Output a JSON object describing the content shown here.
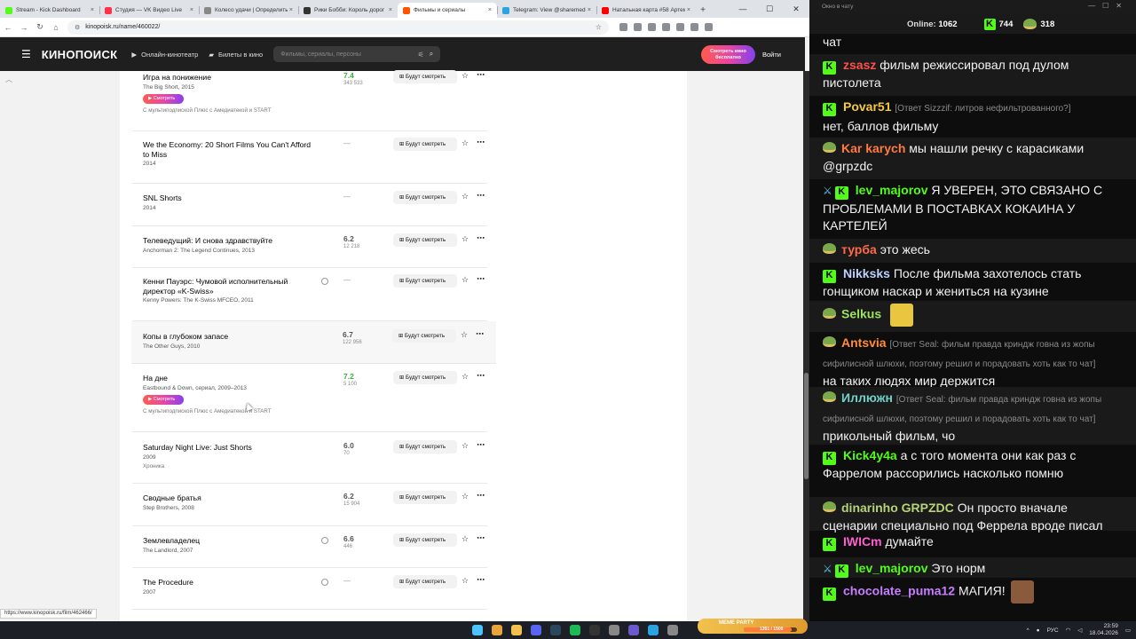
{
  "browser": {
    "tabs": [
      {
        "label": "Stream - Kick Dashboard",
        "color": "#53fc18"
      },
      {
        "label": "Студия — VK Видео Live",
        "color": "#ff3347"
      },
      {
        "label": "Колесо удачи | Определить",
        "color": "#888888"
      },
      {
        "label": "Рики Бобби: Король дорог",
        "color": "#333333"
      },
      {
        "label": "Фильмы и сериалы",
        "color": "#ff5500",
        "active": true
      },
      {
        "label": "Telegram: View @sharemed",
        "color": "#2aa3e0"
      },
      {
        "label": "Натальная карта #58 Артем",
        "color": "#ff0000"
      }
    ],
    "url": "kinopoisk.ru/name/460022/",
    "status_url": "https://www.kinopoisk.ru/film/462466/"
  },
  "kp": {
    "logo": "КИНОПОИСК",
    "nav_online": "Онлайн-кинотеатр",
    "nav_tickets": "Билеты в кино",
    "search_placeholder": "Фильмы, сериалы, персоны",
    "promo": "Смотреть кино бесплатно",
    "login": "Войти",
    "watch_label": "Будут смотреть",
    "watch_pill": "Смотреть"
  },
  "films": [
    {
      "title": "Игра на понижение",
      "sub": "The Big Short, 2015",
      "rating": "7.4",
      "votes": "343 533",
      "green": true,
      "pill": true,
      "extra": "С мультиподпиской Плюс с Амедиатекой и START"
    },
    {
      "title": "We the Economy: 20 Short Films You Can't Afford to Miss",
      "sub": "2014",
      "rating": "—"
    },
    {
      "title": "SNL Shorts",
      "sub": "2014",
      "rating": "—"
    },
    {
      "title": "Телеведущий: И снова здравствуйте",
      "sub": "Anchorman 2: The Legend Continues, 2013",
      "rating": "6.2",
      "votes": "12 218"
    },
    {
      "title": "Кенни Пауэрс: Чумовой исполнительный директор «K-Swiss»",
      "sub": "Kenny Powers: The K-Swiss MFCEO, 2011",
      "rating": "—",
      "clock": true
    },
    {
      "title": "Копы в глубоком запасе",
      "sub": "The Other Guys, 2010",
      "rating": "6.7",
      "votes": "122 956",
      "hl": true
    },
    {
      "title": "На дне",
      "sub": "Eastbound & Down, сериал, 2009–2013",
      "rating": "7.2",
      "votes": "5 100",
      "green": true,
      "pill": true,
      "extra": "С мультиподпиской Плюс с Амедиатекой и START"
    },
    {
      "title": "Saturday Night Live: Just Shorts",
      "sub": "2009",
      "sub2": "Хроника",
      "rating": "6.0",
      "votes": "70"
    },
    {
      "title": "Сводные братья",
      "sub": "Step Brothers, 2008",
      "rating": "6.2",
      "votes": "15 904"
    },
    {
      "title": "Землевладелец",
      "sub": "The Landlord, 2007",
      "rating": "6.6",
      "votes": "446",
      "clock": true
    },
    {
      "title": "The Procedure",
      "sub": "2007",
      "rating": "—",
      "clock": true
    }
  ],
  "chat": {
    "window_title": "Окно в чату",
    "online_label": "Online:",
    "online": "1062",
    "kick_count": "744",
    "other_count": "318",
    "messages": [
      {
        "user": "",
        "color": "#ffffff",
        "text": "чат",
        "badge": "none"
      },
      {
        "user": "zsasz",
        "color": "#ff4f4f",
        "text": "фильм режиссировал под дулом пистолета",
        "badge": "kick"
      },
      {
        "user": "Povar51",
        "color": "#f5c842",
        "reply": "[Ответ Sizzzif: литров нефильтрованного?]",
        "text": "нет, баллов фильму",
        "badge": "kick"
      },
      {
        "user": "Kar karych",
        "color": "#ff7a3d",
        "text": "мы нашли речку с карасиками @grpzdc",
        "badge": "pep"
      },
      {
        "user": "lev_majorov",
        "color": "#53fc18",
        "text": "Я УВЕРЕН, ЭТО СВЯЗАНО С ПРОБЛЕМАМИ В ПОСТАВКАХ КОКАИНА У КАРТЕЛЕЙ",
        "badge": "sword"
      },
      {
        "user": "турба",
        "color": "#ff6b4a",
        "text": "это жесь",
        "badge": "pep"
      },
      {
        "user": "Nikksks",
        "color": "#bcd0ff",
        "text": "После фильма захотелось стать гонщиком наскар и жениться на кузине",
        "badge": "kick"
      },
      {
        "user": "Selkus",
        "color": "#9de35b",
        "text": "",
        "badge": "pep",
        "emote": "#e8c640"
      },
      {
        "user": "Antsvia",
        "color": "#ff8c3a",
        "reply": "[Ответ Seal: фильм правда криндж говна из жопы сифилисной шлюхи, поэтому решил и порадовать хоть как то чат]",
        "text": "на таких людях мир держится",
        "badge": "pep"
      },
      {
        "user": "Иллюжн",
        "color": "#6fd1c8",
        "reply": "[Ответ Seal: фильм правда криндж говна из жопы сифилисной шлюхи, поэтому решил и порадовать хоть как то чат]",
        "text": "прикольный фильм, чо",
        "badge": "pep"
      },
      {
        "user": "Kick4y4a",
        "color": "#53fc18",
        "text": "а с того момента они как раз с Фаррелом рассорились насколько помню",
        "badge": "kick"
      },
      {
        "user": "dinarinho",
        "color": "#b6d37a",
        "user2": "GRPZDC",
        "text": "Он просто вначале сценарии специально под Феррела вроде писал",
        "badge": "pep"
      },
      {
        "user": "IWICm",
        "color": "#ff5fd0",
        "text": "думайте",
        "badge": "kick"
      },
      {
        "user": "lev_majorov",
        "color": "#53fc18",
        "text": "Это норм",
        "badge": "sword"
      },
      {
        "user": "chocolate_puma12",
        "color": "#c77dff",
        "text": "МАГИЯ!",
        "badge": "kick",
        "emote": "#8a5a3c"
      }
    ]
  },
  "taskbar": {
    "lang": "РУС",
    "time": "23:59",
    "date": "18.04.2026",
    "meme_label": "MEME PARTY",
    "meme_progress_text": "1351 / 1500",
    "meme_progress": 0.9
  }
}
